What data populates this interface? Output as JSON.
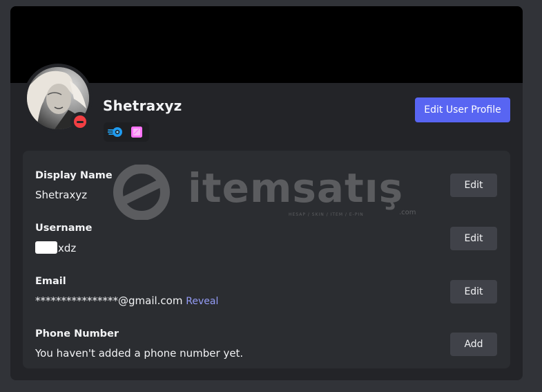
{
  "profile": {
    "username": "Shetraxyz",
    "edit_profile_label": "Edit User Profile",
    "status": "do-not-disturb",
    "badges": [
      "nitro-icon",
      "server-boost-icon"
    ]
  },
  "fields": {
    "display_name": {
      "label": "Display Name",
      "value": "Shetraxyz",
      "action": "Edit"
    },
    "username": {
      "label": "Username",
      "value_suffix": "xdz",
      "action": "Edit"
    },
    "email": {
      "label": "Email",
      "value": "****************@gmail.com",
      "reveal": "Reveal",
      "action": "Edit"
    },
    "phone": {
      "label": "Phone Number",
      "value": "You haven't added a phone number yet.",
      "action": "Add"
    }
  },
  "watermark": {
    "brand": "itemsatış",
    "tagline": "HESAP / SKIN / ITEM / E-PIN",
    "domain": ".com"
  },
  "colors": {
    "accent": "#5865f2",
    "link": "#949cf7",
    "status_dnd": "#f23f43",
    "card_bg": "#232428",
    "panel_bg": "#2b2d31",
    "page_bg": "#313338"
  }
}
